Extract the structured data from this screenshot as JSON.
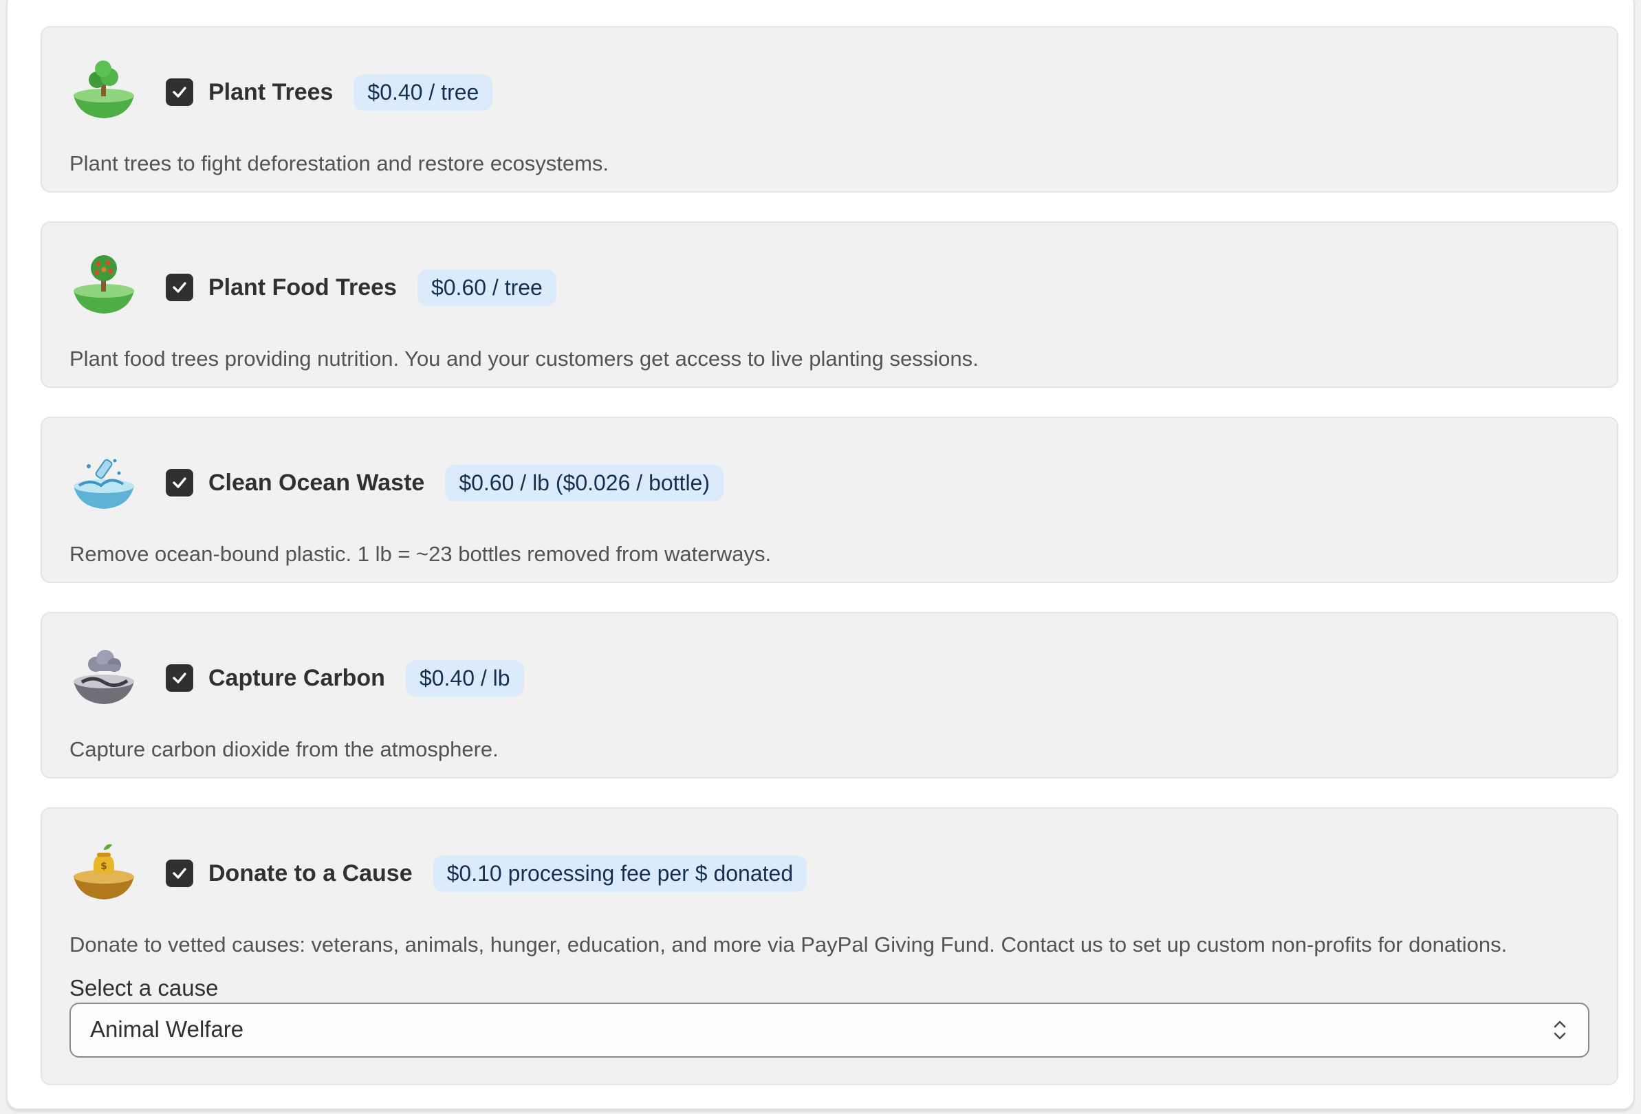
{
  "options": [
    {
      "icon": "tree-island-icon",
      "checked": true,
      "title": "Plant Trees",
      "price": "$0.40 / tree",
      "description": "Plant trees to fight deforestation and restore ecosystems."
    },
    {
      "icon": "fruit-tree-island-icon",
      "checked": true,
      "title": "Plant Food Trees",
      "price": "$0.60 / tree",
      "description": "Plant food trees providing nutrition. You and your customers get access to live planting sessions."
    },
    {
      "icon": "ocean-bottle-icon",
      "checked": true,
      "title": "Clean Ocean Waste",
      "price": "$0.60 / lb ($0.026 / bottle)",
      "description": "Remove ocean-bound plastic. 1 lb = ~23 bottles removed from waterways."
    },
    {
      "icon": "carbon-cloud-icon",
      "checked": true,
      "title": "Capture Carbon",
      "price": "$0.40 / lb",
      "description": "Capture carbon dioxide from the atmosphere."
    },
    {
      "icon": "donation-bag-icon",
      "checked": true,
      "title": "Donate to a Cause",
      "price": "$0.10 processing fee per $ donated",
      "description": "Donate to vetted causes: veterans, animals, hunger, education, and more via PayPal Giving Fund. Contact us to set up custom non-profits for donations."
    }
  ],
  "cause_select": {
    "label": "Select a cause",
    "value": "Animal Welfare"
  }
}
